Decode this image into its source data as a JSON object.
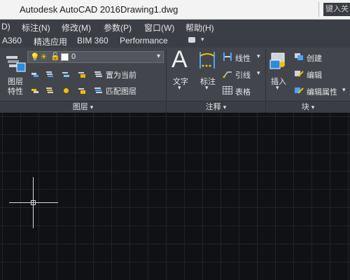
{
  "window": {
    "app_title": "Autodesk AutoCAD 2016",
    "doc_title": "Drawing1.dwg",
    "search_placeholder": "键入关"
  },
  "menu": [
    "D)",
    "标注(N)",
    "修改(M)",
    "参数(P)",
    "窗口(W)",
    "帮助(H)"
  ],
  "tabs": [
    "A360",
    "精选应用",
    "BIM 360",
    "Performance"
  ],
  "ribbon": {
    "layers": {
      "big_button_label_1": "图层",
      "big_button_label_2": "特性",
      "layer_value": "0",
      "make_current": "置为当前",
      "match_layer": "匹配图层",
      "panel_title": "图层"
    },
    "annotation": {
      "text_label": "文字",
      "dimension_label": "标注",
      "linear_label": "线性",
      "leader_label": "引线",
      "table_label": "表格",
      "panel_title": "注释"
    },
    "block": {
      "insert_label": "插入",
      "create_label": "创建",
      "edit_label": "编辑",
      "edit_attr_label": "编辑属性",
      "panel_title": "块"
    }
  },
  "colors": {
    "accent_yellow": "#f2c200",
    "ribbon_bg": "#42464c",
    "canvas_bg": "#0f1114"
  }
}
